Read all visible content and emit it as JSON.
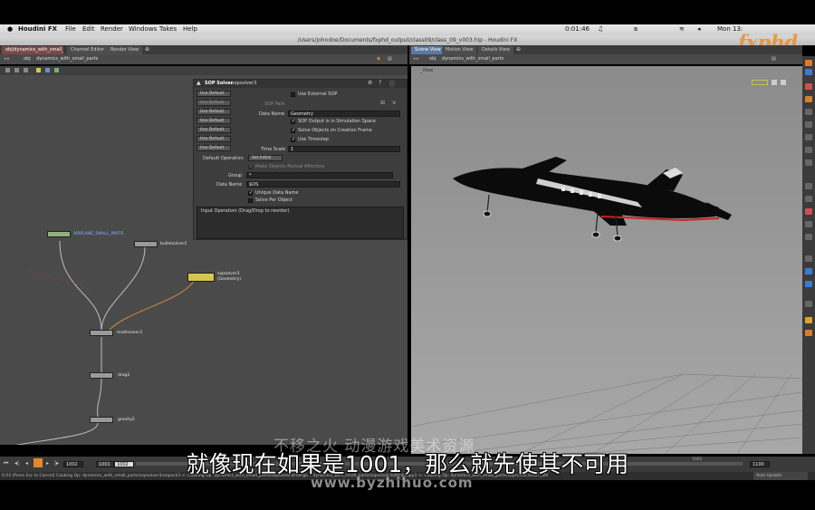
{
  "menubar": {
    "app_name": "Houdini FX",
    "menus": [
      "File",
      "Edit",
      "Render",
      "Windows",
      "Takes",
      "Help"
    ],
    "clock": "Mon 13:",
    "battery": "0:01:46"
  },
  "window": {
    "title": "/Users/johndoe/Documents/fxphd_output/class09/class_09_v003.hip - Houdini FX"
  },
  "left_tabs": [
    "obj/dynamics_with_small_pa...",
    "Channel Editor",
    "Render View"
  ],
  "right_tabs": [
    "Scene View",
    "Motion View",
    "Details View"
  ],
  "left_path": [
    "obj",
    "dynamics_with_small_parts"
  ],
  "right_path": [
    "obj",
    "dynamics_with_small_parts"
  ],
  "params": {
    "header_type": "SOP Solver",
    "header_name": "sopsolver3",
    "use_default_buttons": [
      "Use Default",
      "Use Default",
      "Use Default",
      "Use Default",
      "Use Default",
      "Use Default",
      "Use Default"
    ],
    "use_external_sop": "Use External SOP",
    "sop_path": "SOP Path",
    "data_name_label": "Data Name",
    "data_name_value": "Geometry",
    "chk_sop_output": "SOP Output is in Simulation Space",
    "chk_solve_objects": "Solve Objects on Creation Frame",
    "chk_use_timestep": "Use Timestep",
    "time_scale_label": "Time Scale",
    "time_scale_value": "1",
    "default_operation_label": "Default Operation",
    "default_operation_value": "Set Initial",
    "make_objects_mutual": "Make Objects Mutual Affectors",
    "group_label": "Group",
    "group_value": "*",
    "data_name2_label": "Data Name",
    "data_name2_value": "$OS",
    "unique_data_name": "Unique Data Name",
    "solve_per_object": "Solve Per Object",
    "input_operators": "Input Operators (Drag/Drop to reorder)"
  },
  "nodes": {
    "airplane": "AIRPLANE_SMALL_PARTS",
    "bulletsolver": "bulletsolver2",
    "sopsolver": "sopsolver3",
    "sopsolver_sub": "(Geometry)",
    "multisolver": "multisolver3",
    "drag": "drag2",
    "gravity": "gravity2"
  },
  "viewport": {
    "label": "_View"
  },
  "timeline": {
    "start": "1002",
    "current": "1001",
    "frame": "1002",
    "end": "1100",
    "mid_marker": "1002",
    "auto_update": "Auto Update"
  },
  "status": "0.03 (Press Esc to Cancel) Cooking Op: dynamics_with_small_parts/sopsolver3/unpack3 <- Cooking Op: dynamics_with_small_parts/sopsolver3/merge... dynamics_with_small_parts/sopsolver3/attribcopy3 <- Cooking Op: dynamics_with_small_parts/sopsolver3/OUT_SM",
  "subtitle": "就像现在如果是1001，那么就先使其不可用",
  "watermark_cn": "不移之火 动漫游戏美术资源",
  "watermark_url": "www.byzhihuo.com",
  "logo": "fxphd",
  "colors": {
    "accent": "#d8c64a",
    "panel": "#4a4a4a",
    "viewport": "#9c9c9c"
  }
}
